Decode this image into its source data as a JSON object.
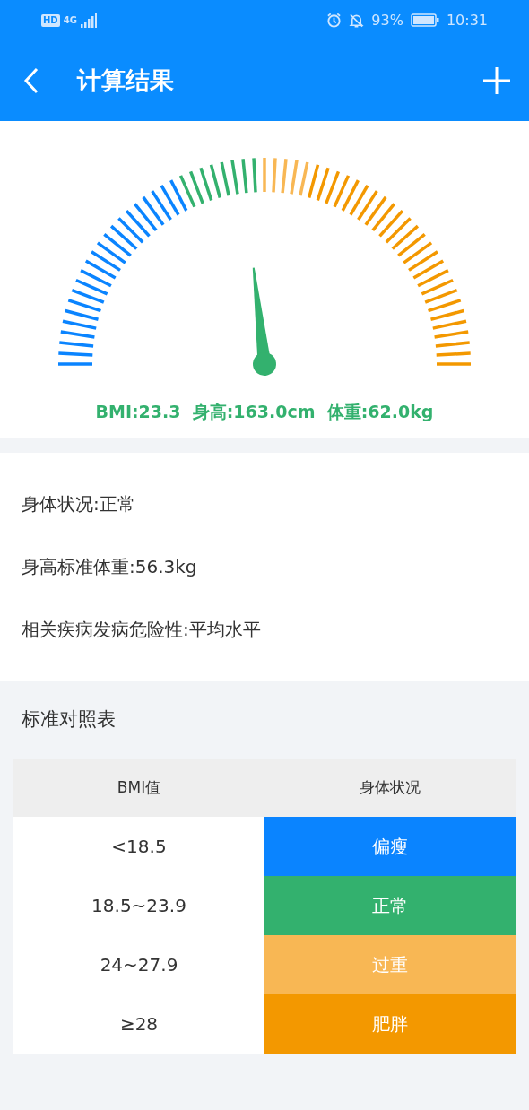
{
  "status_bar": {
    "left": [
      "HD",
      "4G"
    ],
    "battery": "93%",
    "time": "10:31"
  },
  "app_bar": {
    "title": "计算结果"
  },
  "gauge": {
    "reading": "BMI:23.3  身高:163.0cm  体重:62.0kg"
  },
  "details": [
    "身体状况:正常",
    "身高标准体重:56.3kg",
    "相关疾病发病危险性:平均水平"
  ],
  "table": {
    "title": "标准对照表",
    "columns": [
      "BMI值",
      "身体状况"
    ],
    "rows": [
      {
        "range": "<18.5",
        "status": "偏瘦",
        "color": "#0a84ff"
      },
      {
        "range": "18.5~23.9",
        "status": "正常",
        "color": "#33b16e"
      },
      {
        "range": "24~27.9",
        "status": "过重",
        "color": "#f8b754"
      },
      {
        "range": "≥28",
        "status": "肥胖",
        "color": "#f39800"
      }
    ]
  }
}
